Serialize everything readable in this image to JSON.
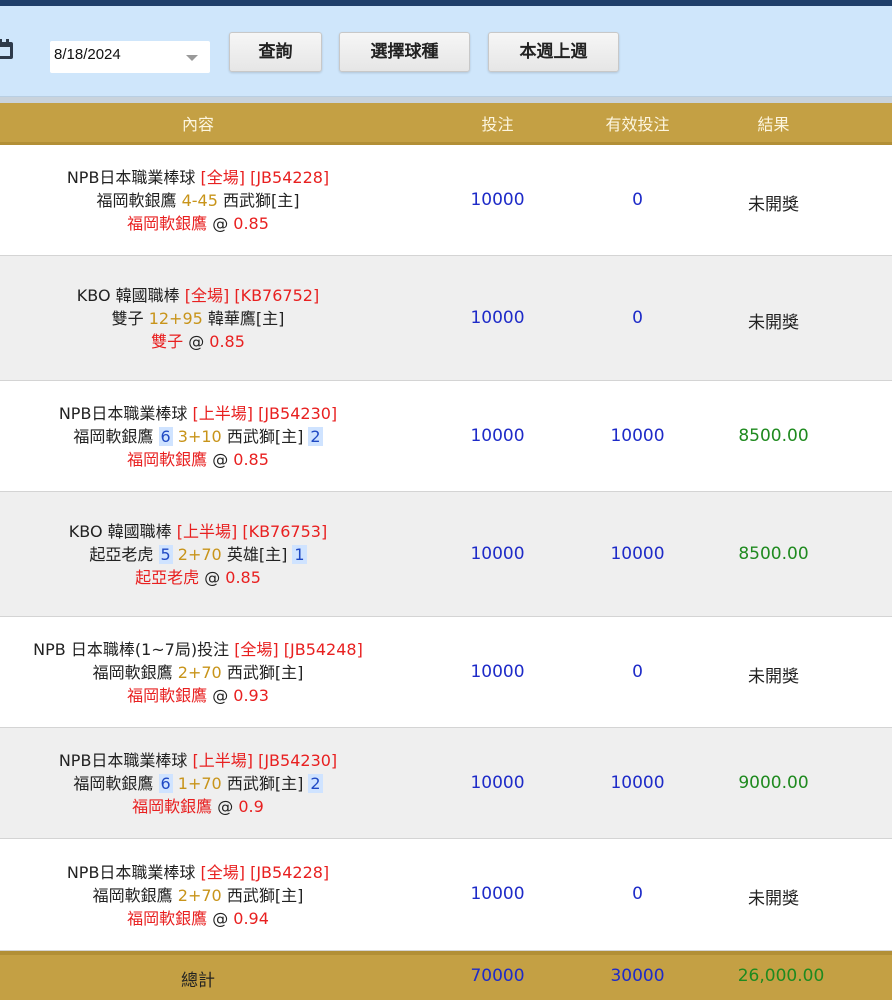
{
  "toolbar": {
    "date": "8/18/2024",
    "query_label": "查詢",
    "sport_label": "選擇球種",
    "week_label": "本週上週"
  },
  "table": {
    "headers": [
      "內容",
      "投注",
      "有效投注",
      "結果"
    ],
    "rows": [
      {
        "league": "NPB日本職業棒球 ",
        "market": "[全場] [JB54228]",
        "home": "福岡軟銀鷹",
        "home_score": "",
        "line": "4-45",
        "away": "西武獅[主]",
        "away_score": "",
        "pick": "福岡軟銀鷹",
        "odds": "0.85",
        "stake": "10000",
        "valid": "0",
        "result": "未開獎",
        "result_status": "pending"
      },
      {
        "league": "KBO 韓國職棒 ",
        "market": "[全場] [KB76752]",
        "home": "雙子",
        "home_score": "",
        "line": "12+95",
        "away": "韓華鷹[主]",
        "away_score": "",
        "pick": "雙子",
        "odds": "0.85",
        "stake": "10000",
        "valid": "0",
        "result": "未開獎",
        "result_status": "pending"
      },
      {
        "league": "NPB日本職業棒球 ",
        "market": "[上半場] [JB54230]",
        "home": "福岡軟銀鷹",
        "home_score": "6",
        "line": "3+10",
        "away": "西武獅[主]",
        "away_score": "2",
        "pick": "福岡軟銀鷹",
        "odds": "0.85",
        "stake": "10000",
        "valid": "10000",
        "result": "8500.00",
        "result_status": "win"
      },
      {
        "league": "KBO 韓國職棒 ",
        "market": "[上半場] [KB76753]",
        "home": "起亞老虎",
        "home_score": "5",
        "line": "2+70",
        "away": "英雄[主]",
        "away_score": "1",
        "pick": "起亞老虎",
        "odds": "0.85",
        "stake": "10000",
        "valid": "10000",
        "result": "8500.00",
        "result_status": "win"
      },
      {
        "league": "NPB 日本職棒(1~7局)投注 ",
        "market": "[全場] [JB54248]",
        "home": "福岡軟銀鷹",
        "home_score": "",
        "line": "2+70",
        "away": "西武獅[主]",
        "away_score": "",
        "pick": "福岡軟銀鷹",
        "odds": "0.93",
        "stake": "10000",
        "valid": "0",
        "result": "未開獎",
        "result_status": "pending"
      },
      {
        "league": "NPB日本職業棒球 ",
        "market": "[上半場] [JB54230]",
        "home": "福岡軟銀鷹",
        "home_score": "6",
        "line": "1+70",
        "away": "西武獅[主]",
        "away_score": "2",
        "pick": "福岡軟銀鷹",
        "odds": "0.9",
        "stake": "10000",
        "valid": "10000",
        "result": "9000.00",
        "result_status": "win"
      },
      {
        "league": "NPB日本職業棒球 ",
        "market": "[全場] [JB54228]",
        "home": "福岡軟銀鷹",
        "home_score": "",
        "line": "2+70",
        "away": "西武獅[主]",
        "away_score": "",
        "pick": "福岡軟銀鷹",
        "odds": "0.94",
        "stake": "10000",
        "valid": "0",
        "result": "未開獎",
        "result_status": "pending"
      }
    ]
  },
  "totals": {
    "label": "總計",
    "stake": "70000",
    "valid": "30000",
    "result": "26,000.00"
  },
  "colors": {
    "header_gold": "#c4a044",
    "toolbar_blue": "#cfe6fb",
    "win_green": "#1f8a1f",
    "market_red": "#e82020",
    "line_gold": "#c8941a",
    "amount_blue": "#1e2bc8"
  },
  "icons": {
    "calendar": "calendar-icon",
    "dropdown": "chevron-down-icon"
  }
}
